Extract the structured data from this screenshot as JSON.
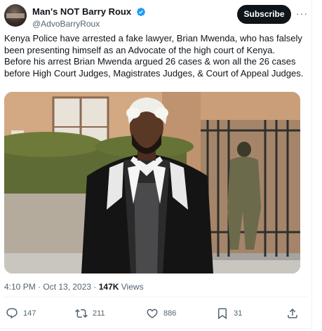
{
  "author": {
    "display_name": "Man's NOT Barry Roux",
    "handle": "@AdvoBarryRoux"
  },
  "subscribe_label": "Subscribe",
  "more_label": "···",
  "tweet": {
    "text": "Kenya Police have arrested a fake lawyer, Brian Mwenda, who has falsely been presenting himself as an Advocate of the high court of Kenya.\nBefore his arrest Brian Mwenda argued 26 cases & won all the 26 cases before High Court Judges, Magistrates Judges, & Court of Appeal Judges."
  },
  "meta": {
    "timestamp": "4:10 PM · Oct 13, 2023",
    "separator": " · ",
    "views_count": "147K",
    "views_label": " Views"
  },
  "actions": {
    "replies": "147",
    "reposts": "211",
    "likes": "886",
    "bookmarks": "31"
  },
  "colors": {
    "accent_verified": "#1d9bf0",
    "text_primary": "#0f1419",
    "text_secondary": "#536471"
  },
  "icons": [
    "verified-badge-icon",
    "more-icon",
    "reply-icon",
    "repost-icon",
    "like-icon",
    "bookmark-icon",
    "share-icon"
  ]
}
